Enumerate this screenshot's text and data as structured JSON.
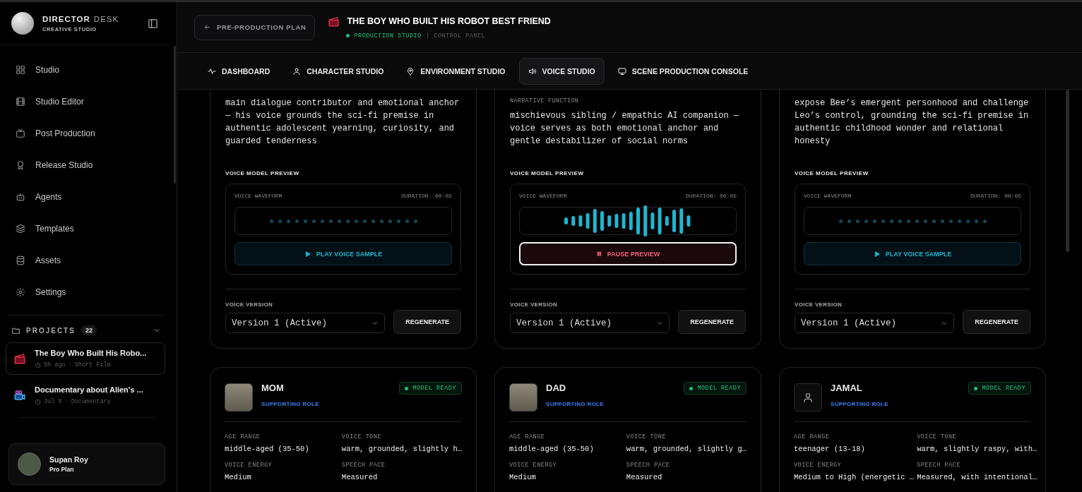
{
  "sidebar": {
    "brand": {
      "name": "DIRECTOR",
      "name_light": "DESK",
      "subtitle": "CREATIVE STUDIO"
    },
    "nav": [
      {
        "label": "Studio",
        "selected": false
      },
      {
        "label": "Studio Editor",
        "selected": false
      },
      {
        "label": "Post Production",
        "selected": false
      },
      {
        "label": "Release Studio",
        "selected": false
      },
      {
        "label": "Agents",
        "selected": false
      },
      {
        "label": "Templates",
        "selected": false
      },
      {
        "label": "Assets",
        "selected": false
      },
      {
        "label": "Settings",
        "selected": false
      }
    ],
    "projects": {
      "title": "PROJECTS",
      "count": "22",
      "items": [
        {
          "title": "The Boy Who Built His Robo...",
          "time": "5h ago",
          "separator": "·",
          "type": "Short Film",
          "selected": true
        },
        {
          "title": "Documentary about Alien's ...",
          "time": "Jul 9",
          "separator": "·",
          "type": "Documentary",
          "selected": false
        }
      ]
    },
    "user": {
      "name": "Supan Roy",
      "plan": "Pro Plan"
    }
  },
  "header": {
    "back_button": "PRE-PRODUCTION PLAN",
    "title": "THE BOY WHO BUILT HIS ROBOT BEST FRIEND",
    "status": "PRODUCTION STUDIO",
    "separator": "|",
    "subtitle": "CONTROL PANEL"
  },
  "tabs": [
    {
      "label": "DASHBOARD",
      "selected": false
    },
    {
      "label": "CHARACTER STUDIO",
      "selected": false
    },
    {
      "label": "ENVIRONMENT STUDIO",
      "selected": false
    },
    {
      "label": "VOICE STUDIO",
      "selected": true
    },
    {
      "label": "SCENE PRODUCTION CONSOLE",
      "selected": false
    }
  ],
  "voice_cards": [
    {
      "narrative": "main dialogue contributor and emotional anchor — his voice grounds the sci-fi premise in authentic adolescent yearning, curiosity, and guarded tenderness",
      "preview_title": "VOICE MODEL PREVIEW",
      "waveform_label": "VOICE WAVEFORM",
      "duration": "DURATION: 00:05",
      "playing": false,
      "button": "PLAY VOICE SAMPLE",
      "version_label": "VOICE VERSION",
      "version": "Version 1 (Active)",
      "regenerate": "REGENERATE"
    },
    {
      "narrative_label": "NARRATIVE FUNCTION",
      "narrative": "mischievous sibling / empathic AI companion — voice serves as both emotional anchor and gentle destabilizer of social norms",
      "preview_title": "VOICE MODEL PREVIEW",
      "waveform_label": "VOICE WAVEFORM",
      "duration": "DURATION: 00:05",
      "playing": true,
      "button": "PAUSE PREVIEW",
      "version_label": "VOICE VERSION",
      "version": "Version 1 (Active)",
      "regenerate": "REGENERATE"
    },
    {
      "narrative": "expose Bee’s emergent personhood and challenge Leo’s control, grounding the sci-fi premise in authentic childhood wonder and relational honesty",
      "preview_title": "VOICE MODEL PREVIEW",
      "waveform_label": "VOICE WAVEFORM",
      "duration": "DURATION: 00:05",
      "playing": false,
      "button": "PLAY VOICE SAMPLE",
      "version_label": "VOICE VERSION",
      "version": "Version 1 (Active)",
      "regenerate": "REGENERATE"
    }
  ],
  "character_cards": [
    {
      "name": "MOM",
      "role": "SUPPORTING ROLE",
      "kind": "photo",
      "badge": "MODEL READY",
      "fields": [
        {
          "label": "AGE RANGE",
          "value": "middle-aged (35-50)"
        },
        {
          "label": "VOICE TONE",
          "value": "warm, grounded, slightly h…"
        },
        {
          "label": "VOICE ENERGY",
          "value": "Medium"
        },
        {
          "label": "SPEECH PACE",
          "value": "Measured"
        }
      ]
    },
    {
      "name": "DAD",
      "role": "SUPPORTING ROLE",
      "kind": "photo",
      "badge": "MODEL READY",
      "fields": [
        {
          "label": "AGE RANGE",
          "value": "middle-aged (35-50)"
        },
        {
          "label": "VOICE TONE",
          "value": "warm, grounded, slightly g…"
        },
        {
          "label": "VOICE ENERGY",
          "value": "Medium"
        },
        {
          "label": "SPEECH PACE",
          "value": "Measured"
        }
      ]
    },
    {
      "name": "JAMAL",
      "role": "SUPPORTING ROLE",
      "kind": "icon",
      "badge": "MODEL READY",
      "fields": [
        {
          "label": "AGE RANGE",
          "value": "teenager (13-18)"
        },
        {
          "label": "VOICE TONE",
          "value": "warm, slightly raspy, with…"
        },
        {
          "label": "VOICE ENERGY",
          "value": "Medium to High (energetic …"
        },
        {
          "label": "SPEECH PACE",
          "value": "Measured, with intentional…"
        }
      ]
    }
  ]
}
